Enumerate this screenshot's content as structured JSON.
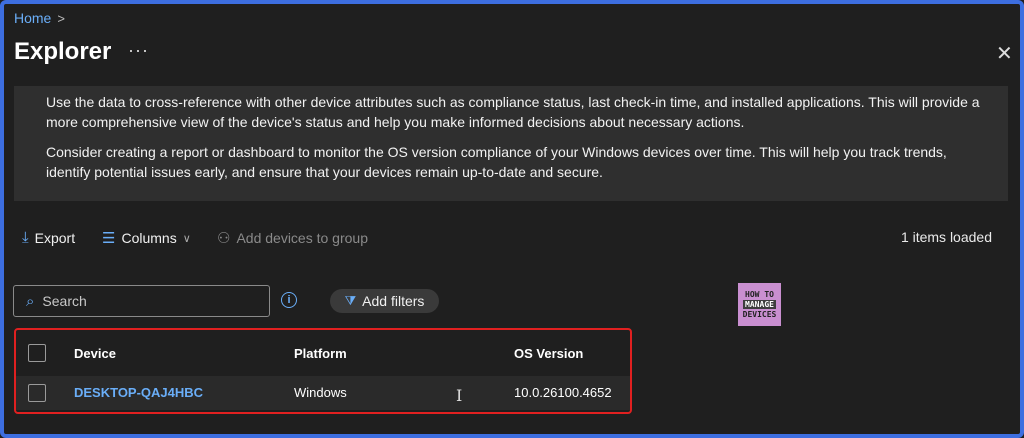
{
  "breadcrumb": {
    "home": "Home",
    "sep": ">"
  },
  "header": {
    "title": "Explorer",
    "more": "···",
    "close": "✕"
  },
  "info": {
    "paragraph1": "Use the data to cross-reference with other device attributes such as compliance status, last check-in time, and installed applications. This will provide a more comprehensive view of the device's status and help you make informed decisions about necessary actions.",
    "paragraph2": "Consider creating a report or dashboard to monitor the OS version compliance of your Windows devices over time. This will help you track trends, identify potential issues early, and ensure that your devices remain up-to-date and secure."
  },
  "toolbar": {
    "export": "Export",
    "columns": "Columns",
    "add_devices": "Add devices to group",
    "items_loaded": "1 items loaded"
  },
  "search": {
    "placeholder": "Search"
  },
  "filters": {
    "label": "Add filters"
  },
  "logo": {
    "top": "HOW TO",
    "mid": "MANAGE",
    "bottom": "DEVICES"
  },
  "table": {
    "headers": [
      "Device",
      "Platform",
      "OS Version"
    ],
    "rows": [
      {
        "device": "DESKTOP-QAJ4HBC",
        "platform": "Windows",
        "os_version": "10.0.26100.4652"
      }
    ]
  },
  "colors": {
    "accent": "#6aaef8",
    "highlight": "#e02020",
    "frame": "#3d6ee0"
  }
}
